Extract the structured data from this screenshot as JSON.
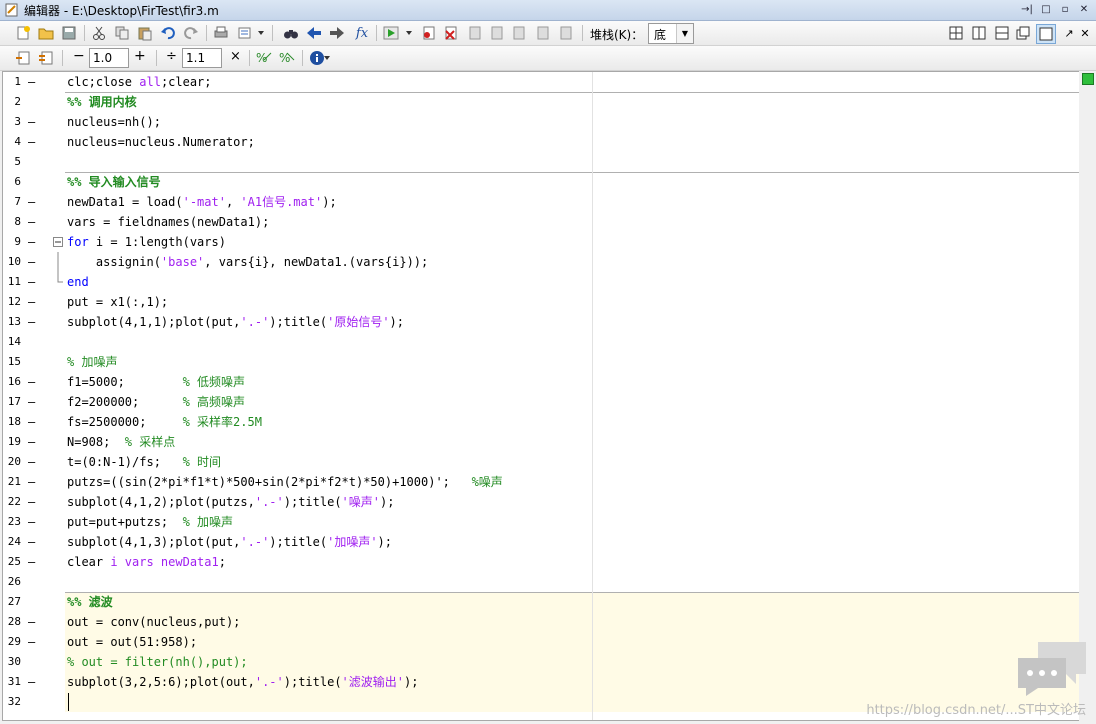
{
  "window": {
    "title": "编辑器 - E:\\Desktop\\FirTest\\fir3.m"
  },
  "window_buttons": [
    "→|",
    "□",
    "▫",
    "✕"
  ],
  "toolbar1": {
    "stack_label": "堆栈(K)：",
    "stack_value": "底",
    "fx_label": "fx"
  },
  "toolbar2": {
    "minus": "−",
    "value1": "1.0",
    "plus": "+",
    "div": "÷",
    "value2": "1.1",
    "times": "×"
  },
  "editor": {
    "lines": [
      {
        "n": "1",
        "dash": "–"
      },
      {
        "n": "2",
        "dash": ""
      },
      {
        "n": "3",
        "dash": "–"
      },
      {
        "n": "4",
        "dash": "–"
      },
      {
        "n": "5",
        "dash": ""
      },
      {
        "n": "6",
        "dash": ""
      },
      {
        "n": "7",
        "dash": "–"
      },
      {
        "n": "8",
        "dash": "–"
      },
      {
        "n": "9",
        "dash": "–"
      },
      {
        "n": "10",
        "dash": "–"
      },
      {
        "n": "11",
        "dash": "–"
      },
      {
        "n": "12",
        "dash": "–"
      },
      {
        "n": "13",
        "dash": "–"
      },
      {
        "n": "14",
        "dash": ""
      },
      {
        "n": "15",
        "dash": ""
      },
      {
        "n": "16",
        "dash": "–"
      },
      {
        "n": "17",
        "dash": "–"
      },
      {
        "n": "18",
        "dash": "–"
      },
      {
        "n": "19",
        "dash": "–"
      },
      {
        "n": "20",
        "dash": "–"
      },
      {
        "n": "21",
        "dash": "–"
      },
      {
        "n": "22",
        "dash": "–"
      },
      {
        "n": "23",
        "dash": "–"
      },
      {
        "n": "24",
        "dash": "–"
      },
      {
        "n": "25",
        "dash": "–"
      },
      {
        "n": "26",
        "dash": ""
      },
      {
        "n": "27",
        "dash": ""
      },
      {
        "n": "28",
        "dash": "–"
      },
      {
        "n": "29",
        "dash": "–"
      },
      {
        "n": "30",
        "dash": ""
      },
      {
        "n": "31",
        "dash": "–"
      },
      {
        "n": "32",
        "dash": ""
      }
    ],
    "code": {
      "l1a": "clc;close ",
      "l1b": "all",
      "l1c": ";clear;",
      "l2": "%% 调用内核",
      "l3": "nucleus=nh();",
      "l4": "nucleus=nucleus.Numerator;",
      "l6": "%% 导入输入信号",
      "l7a": "newData1 = load(",
      "l7b": "'-mat'",
      "l7c": ", ",
      "l7d": "'A1信号.mat'",
      "l7e": ");",
      "l8": "vars = fieldnames(newData1);",
      "l9a": "for",
      "l9b": " i = 1:length(vars)",
      "l10a": "    assignin(",
      "l10b": "'base'",
      "l10c": ", vars{i}, newData1.(vars{i}));",
      "l11": "end",
      "l12": "put = x1(:,1);",
      "l13a": "subplot(4,1,1);plot(put,",
      "l13b": "'.-'",
      "l13c": ");title(",
      "l13d": "'原始信号'",
      "l13e": ");",
      "l15": "% 加噪声",
      "l16a": "f1=5000;        ",
      "l16b": "% 低频噪声",
      "l17a": "f2=200000;      ",
      "l17b": "% 高频噪声",
      "l18a": "fs=2500000;     ",
      "l18b": "% 采样率2.5M",
      "l19a": "N=908;  ",
      "l19b": "% 采样点",
      "l20a": "t=(0:N-1)/fs;   ",
      "l20b": "% 时间",
      "l21a": "putzs=((sin(2*pi*f1*t)*500+sin(2*pi*f2*t)*50)+1000)';   ",
      "l21b": "%噪声",
      "l22a": "subplot(4,1,2);plot(putzs,",
      "l22b": "'.-'",
      "l22c": ");title(",
      "l22d": "'噪声'",
      "l22e": ");",
      "l23a": "put=put+putzs;  ",
      "l23b": "% 加噪声",
      "l24a": "subplot(4,1,3);plot(put,",
      "l24b": "'.-'",
      "l24c": ");title(",
      "l24d": "'加噪声'",
      "l24e": ");",
      "l25a": "clear ",
      "l25b": "i vars newData1",
      "l25c": ";",
      "l27": "%% 滤波",
      "l28": "out = conv(nucleus,put);",
      "l29": "out = out(51:958);",
      "l30": "% out = filter(nh(),put);",
      "l31a": "subplot(3,2,5:6);plot(out,",
      "l31b": "'.-'",
      "l31c": ");title(",
      "l31d": "'滤波输出'",
      "l31e": ");"
    }
  },
  "watermark": "https://blog.csdn.net/...ST中文论坛"
}
